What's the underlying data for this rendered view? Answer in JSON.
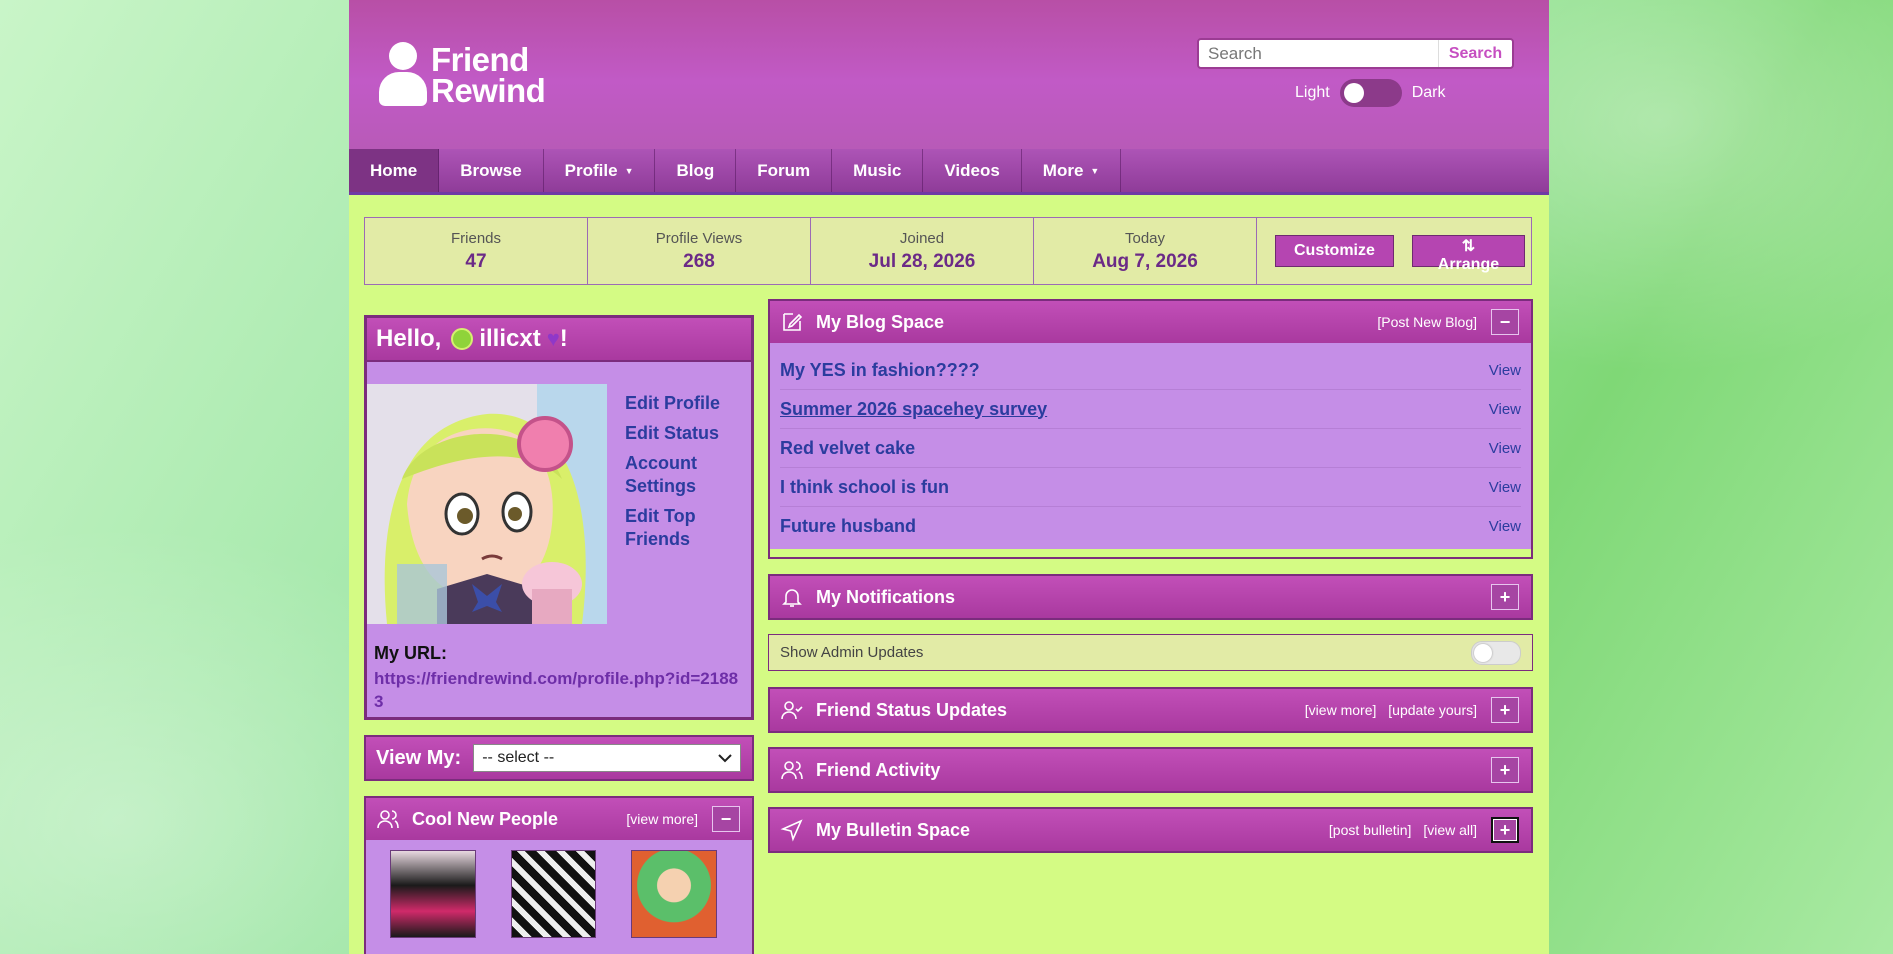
{
  "brand": {
    "logo_line1": "Friend",
    "logo_line2": "Rewind"
  },
  "search": {
    "placeholder": "Search",
    "button": "Search"
  },
  "theme": {
    "light": "Light",
    "dark": "Dark"
  },
  "nav": {
    "home": "Home",
    "browse": "Browse",
    "profile": "Profile",
    "blog": "Blog",
    "forum": "Forum",
    "music": "Music",
    "videos": "Videos",
    "more": "More"
  },
  "stats": {
    "friends_label": "Friends",
    "friends_value": "47",
    "views_label": "Profile Views",
    "views_value": "268",
    "joined_label": "Joined",
    "joined_value": "Jul 28, 2026",
    "today_label": "Today",
    "today_value": "Aug 7, 2026",
    "customize": "Customize",
    "arrange": "⇅ Arrange"
  },
  "profile": {
    "hello": "Hello,",
    "username": "illicxt",
    "exclaim": "!",
    "links": {
      "edit_profile": "Edit Profile",
      "edit_status": "Edit Status",
      "account_settings": "Account Settings",
      "edit_top_friends": "Edit Top Friends"
    },
    "url_label": "My URL:",
    "url_value": "https://friendrewind.com/profile.php?id=21883"
  },
  "viewmy": {
    "label": "View My:",
    "selected": "-- select --"
  },
  "cool_people": {
    "title": "Cool New People",
    "view_more": "[view more]",
    "toggle": "−"
  },
  "blog": {
    "title": "My Blog Space",
    "post_new": "[Post New Blog]",
    "toggle": "−",
    "entries": [
      {
        "title": "My YES in fashion????",
        "view": "View"
      },
      {
        "title": "Summer 2026 spacehey survey",
        "view": "View"
      },
      {
        "title": "Red velvet cake",
        "view": "View"
      },
      {
        "title": "I think school is fun",
        "view": "View"
      },
      {
        "title": "Future husband",
        "view": "View"
      }
    ]
  },
  "notifications": {
    "title": "My Notifications",
    "toggle": "+"
  },
  "admin": {
    "label": "Show Admin Updates"
  },
  "status_updates": {
    "title": "Friend Status Updates",
    "view_more": "[view more]",
    "update_yours": "[update yours]",
    "toggle": "+"
  },
  "activity": {
    "title": "Friend Activity",
    "toggle": "+"
  },
  "bulletin": {
    "title": "My Bulletin Space",
    "post": "[post bulletin]",
    "view_all": "[view all]",
    "toggle": "+"
  },
  "colors": {
    "header": "#c15ac6",
    "page_bg": "#d4fb84",
    "panel": "#c58ee7",
    "link": "#2b3c9e",
    "accent": "#b545b1"
  }
}
